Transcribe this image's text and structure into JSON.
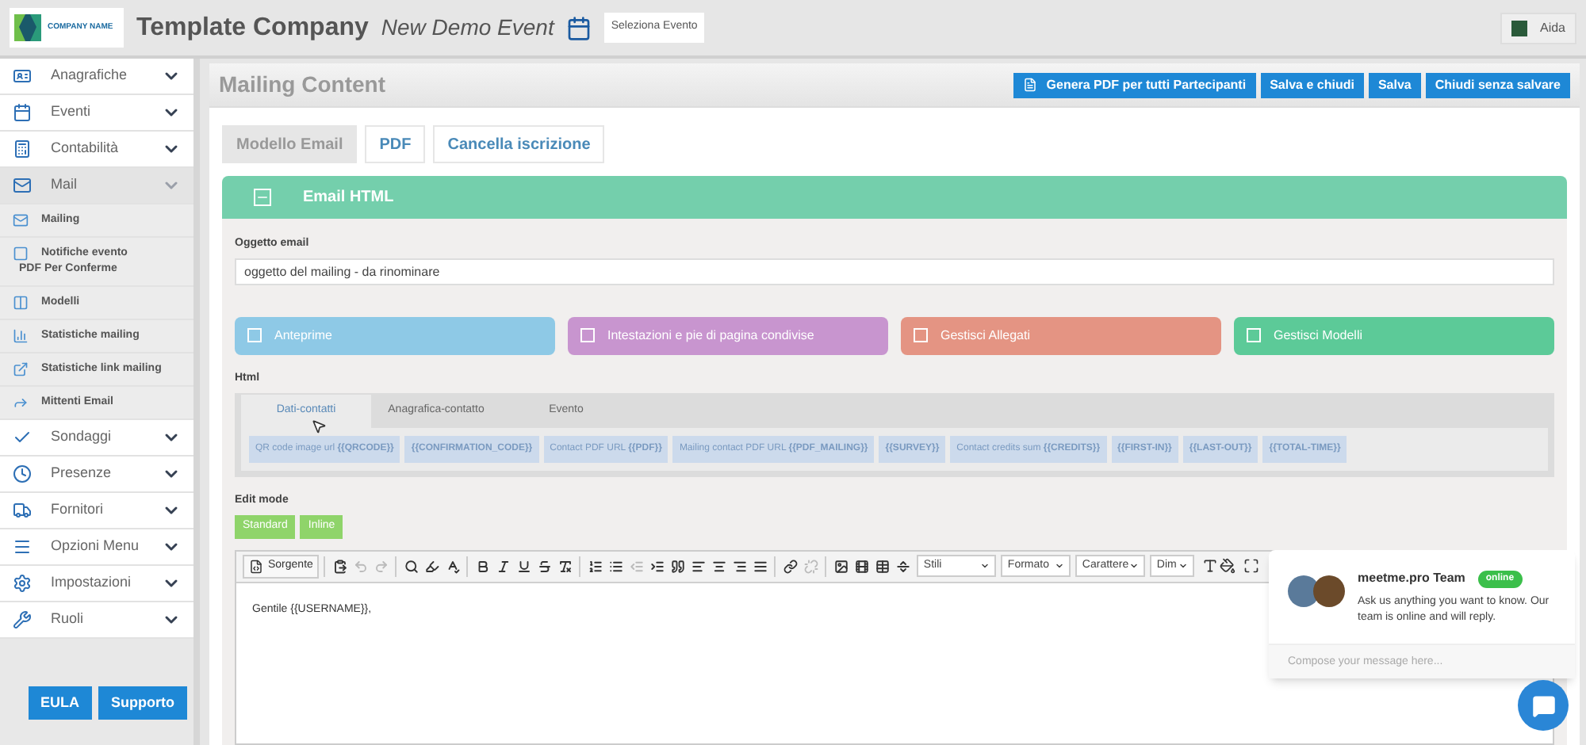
{
  "header": {
    "logo_text": "COMPANY NAME",
    "company": "Template Company",
    "event": "New Demo Event",
    "select_event_button": "Seleziona Evento",
    "user": "Aida"
  },
  "sidebar": {
    "items": [
      {
        "label": "Anagrafiche",
        "selected": false,
        "expanded": false
      },
      {
        "label": "Eventi",
        "selected": false,
        "expanded": false
      },
      {
        "label": "Contabilità",
        "selected": false,
        "expanded": false
      },
      {
        "label": "Mail",
        "selected": true,
        "expanded": true,
        "children": [
          {
            "label": "Mailing"
          },
          {
            "label": "Notifiche evento",
            "label_2": "PDF Per Conferme"
          },
          {
            "label": "Modelli"
          },
          {
            "label": "Statistiche mailing"
          },
          {
            "label": "Statistiche link mailing"
          },
          {
            "label": "Mittenti Email"
          }
        ]
      },
      {
        "label": "Sondaggi",
        "selected": false,
        "expanded": false
      },
      {
        "label": "Presenze",
        "selected": false,
        "expanded": false
      },
      {
        "label": "Fornitori",
        "selected": false,
        "expanded": false
      },
      {
        "label": "Opzioni Menu",
        "selected": false,
        "expanded": false
      },
      {
        "label": "Impostazioni",
        "selected": false,
        "expanded": false
      },
      {
        "label": "Ruoli",
        "selected": false,
        "expanded": false
      }
    ],
    "footer_buttons": [
      "EULA",
      "Supporto"
    ]
  },
  "page": {
    "title": "Mailing Content",
    "actions": [
      "Genera PDF per tutti Partecipanti",
      "Salva e chiudi",
      "Salva",
      "Chiudi senza salvare"
    ],
    "tabs": [
      {
        "label": "Modello Email",
        "selected": true
      },
      {
        "label": "PDF",
        "selected": false
      },
      {
        "label": "Cancella iscrizione",
        "selected": false
      }
    ],
    "section_title": "Email HTML",
    "subject": {
      "label": "Oggetto email",
      "value": "oggetto del mailing - da rinominare"
    },
    "panels": [
      {
        "label": "Anteprime",
        "color": "#8ec9e6",
        "checked": false
      },
      {
        "label": "Intestazioni e pie di pagina condivise",
        "color": "#c895cf",
        "checked": false
      },
      {
        "label": "Gestisci Allegati",
        "color": "#e49483",
        "checked": false
      },
      {
        "label": "Gestisci Modelli",
        "color": "#5cca98",
        "checked": false
      }
    ],
    "html_label": "Html",
    "field_tabs": [
      {
        "label": "Dati-contatti",
        "selected": true
      },
      {
        "label": "Anagrafica-contatto",
        "selected": false
      },
      {
        "label": "Evento",
        "selected": false
      }
    ],
    "fields": [
      "QR code image url **{{QRCODE}}**",
      "**{{CONFIRMATION_CODE}}**",
      "Contact PDF URL **{{PDF}}**",
      "Mailing contact PDF URL **{{PDF_MAILING}}**",
      "**{{SURVEY}}**",
      "Contact credits sum **{{CREDITS}}**",
      "**{{FIRST-IN}}**",
      "**{{LAST-OUT}}**",
      "**{{TOTAL-TIME}}**"
    ],
    "edit_mode": {
      "label": "Edit mode",
      "buttons": [
        "Standard",
        "Inline"
      ]
    },
    "toolbar": {
      "source_label": "Sorgente",
      "buttons": [
        {
          "disabled": false
        },
        {
          "disabled": true
        },
        {
          "disabled": true
        },
        {
          "disabled": false
        },
        {
          "disabled": false
        },
        {
          "disabled": false
        },
        {
          "disabled": false
        },
        {
          "disabled": false
        },
        {
          "disabled": false
        },
        {
          "disabled": false
        },
        {
          "disabled": false
        },
        {
          "disabled": false
        },
        {
          "disabled": false
        },
        {
          "disabled": true
        },
        {
          "disabled": false
        },
        {
          "disabled": false
        },
        {
          "disabled": false
        },
        {
          "disabled": false
        },
        {
          "disabled": false
        },
        {
          "disabled": false
        },
        {
          "disabled": false
        },
        {
          "disabled": true
        },
        {
          "disabled": false
        },
        {
          "disabled": false
        },
        {
          "disabled": false
        },
        {
          "disabled": false
        }
      ],
      "dropdowns": [
        "Stili",
        "Formato",
        "Carattere",
        "Dim"
      ]
    },
    "editor_text": "Gentile {{USERNAME}},"
  },
  "chat": {
    "team": "meetme.pro Team",
    "status": "online",
    "message": "Ask us anything you want to know. Our team is online and will reply.",
    "placeholder": "Compose your message here..."
  }
}
